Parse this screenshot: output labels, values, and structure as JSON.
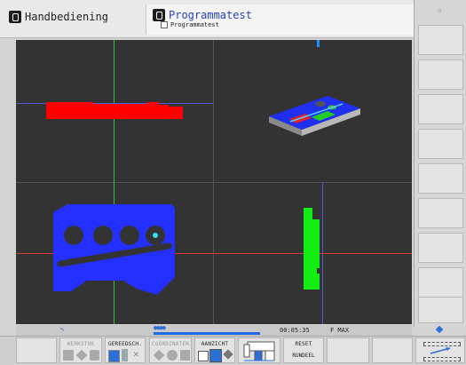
{
  "header": {
    "mode_left": "Handbediening",
    "mode_right": "Programmatest",
    "program_name": "Programmatest"
  },
  "status": {
    "time": "00:05:35",
    "feed": "F MAX"
  },
  "softkeys": [
    {
      "label": "",
      "enabled": false
    },
    {
      "label": "WERKSTUK",
      "enabled": false
    },
    {
      "label": "GEREEDSCH.",
      "enabled": true
    },
    {
      "label": "COÖRDINATEN",
      "enabled": false
    },
    {
      "label": "AANZICHT",
      "enabled": true
    },
    {
      "label": "",
      "enabled": true
    },
    {
      "label": "RESET",
      "sub": "RUNDEEL",
      "enabled": true
    },
    {
      "label": "",
      "enabled": false
    },
    {
      "label": "",
      "enabled": false
    }
  ],
  "colors": {
    "part_blue": "#2330ff",
    "part_red": "#ff0000",
    "part_green": "#12ee12",
    "viewport_bg": "#333333",
    "title_blue": "#2742c9"
  },
  "icons": [
    "machine-mode-icon",
    "program-test-icon",
    "file-icon",
    "settings-icon",
    "graphics-icon",
    "scale-icon"
  ]
}
